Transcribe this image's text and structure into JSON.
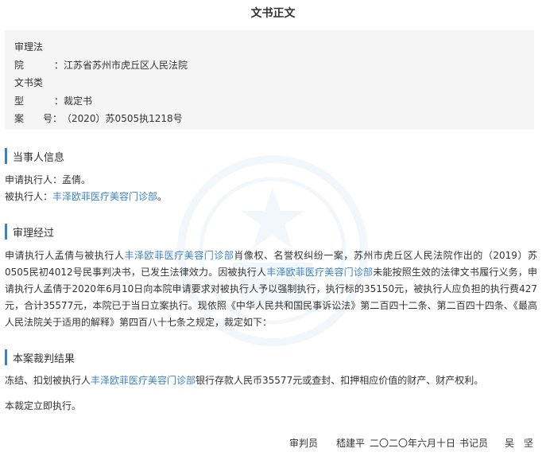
{
  "doc_title": "文书正文",
  "meta": {
    "court_label_1": "审理法",
    "court_label_2": "院",
    "court_value": "：江苏省苏州市虎丘区人民法院",
    "type_label_1": "文书类",
    "type_label_2": "型",
    "type_value": "：裁定书",
    "case_label": "案　　号：",
    "case_value": "（2020）苏0505执1218号"
  },
  "parties": {
    "heading": "当事人信息",
    "applicant_label": "申请执行人：",
    "applicant_name": "孟倩",
    "applicant_end": "。",
    "respondent_label": "被执行人：",
    "respondent_name": "丰泽欧菲医疗美容门诊部",
    "respondent_end": "。"
  },
  "process": {
    "heading": "审理经过",
    "p1_a": "申请执行人孟倩与被执行人",
    "p1_link": "丰泽欧菲医疗美容门诊部",
    "p1_b": "肖像权、名誉权纠纷一案，苏州市虎丘区人民法院作出的（2019）苏0505民初4012号民事判决书，已发生法律效力。因被执行人",
    "p1_link2": "丰泽欧菲医疗美容门诊部",
    "p1_c": "未能按照生效的法律文书履行义务，申请执行人孟倩于2020年6月10日向本院申请要求对被执行人予以强制执行，执行标的35150元，被执行人应负担的执行费427元，合计35577元，本院已于当日立案执行。现依照《中华人民共和国民事诉讼法》第二百四十二条、第二百四十四条、《最高人民法院关于适用的解释》第四百八十七条之规定，裁定如下："
  },
  "ruling": {
    "heading": "本案裁判结果",
    "p1_a": "冻结、扣划被执行人",
    "p1_link": "丰泽欧菲医疗美容门诊部",
    "p1_b": "银行存款人民币35577元或查封、扣押相应价值的财产、财产权利。",
    "p2": "本裁定立即执行。"
  },
  "footer": {
    "judge_label": "审判员",
    "judge_name": "嵇建平",
    "date": "二〇二〇年六月十日",
    "clerk_label": "书记员",
    "clerk_name": "吴　坚"
  },
  "colors": {
    "accent": "#3b82c4",
    "meta_bg": "#f5f5f5"
  }
}
